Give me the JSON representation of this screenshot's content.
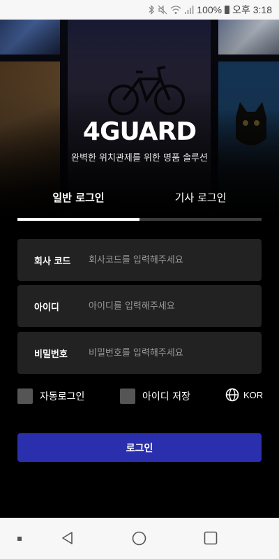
{
  "status_bar": {
    "battery_percent": "100%",
    "time": "오후 3:18",
    "icons": [
      "bluetooth-icon",
      "mute-icon",
      "wifi-icon",
      "signal-icon",
      "battery-icon"
    ]
  },
  "brand": {
    "logo_text": "4GUARD",
    "tagline": "완벽한 위치관제를 위한 명품 솔루션"
  },
  "tabs": [
    {
      "label": "일반 로그인",
      "active": true
    },
    {
      "label": "기사 로그인",
      "active": false
    }
  ],
  "fields": {
    "company_code": {
      "label": "회사 코드",
      "placeholder": "회사코드를 입력해주세요",
      "value": ""
    },
    "user_id": {
      "label": "아이디",
      "placeholder": "아이디를 입력해주세요",
      "value": ""
    },
    "password": {
      "label": "비밀번호",
      "placeholder": "비밀번호를 입력해주세요",
      "value": ""
    }
  },
  "options": {
    "auto_login_label": "자동로그인",
    "auto_login_checked": false,
    "save_id_label": "아이디 저장",
    "save_id_checked": false,
    "language_label": "KOR"
  },
  "login_button_label": "로그인",
  "colors": {
    "accent": "#2a2fae",
    "field_bg": "#222222",
    "checkbox": "#555555"
  }
}
